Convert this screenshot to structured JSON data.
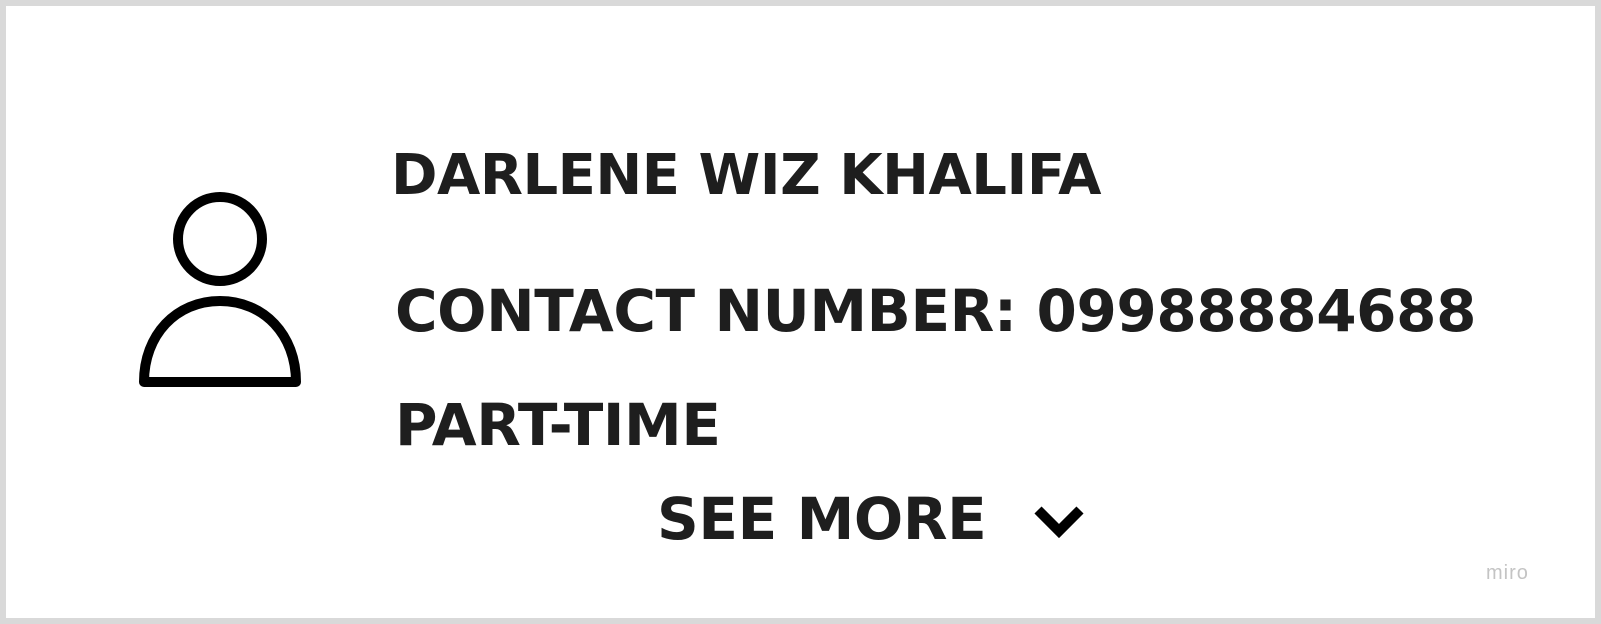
{
  "card": {
    "name": "DARLENE WIZ KHALIFA",
    "contact": "CONTACT NUMBER: 09988884688",
    "employment": "PART-TIME",
    "see_more_label": "SEE MORE",
    "avatar_icon": "user-icon",
    "expand_icon": "chevron-down-icon"
  },
  "watermark": "miro",
  "colors": {
    "text": "#1e1e1e",
    "border": "#d9d9d9",
    "watermark": "#c4c4c4",
    "background": "#ffffff"
  }
}
